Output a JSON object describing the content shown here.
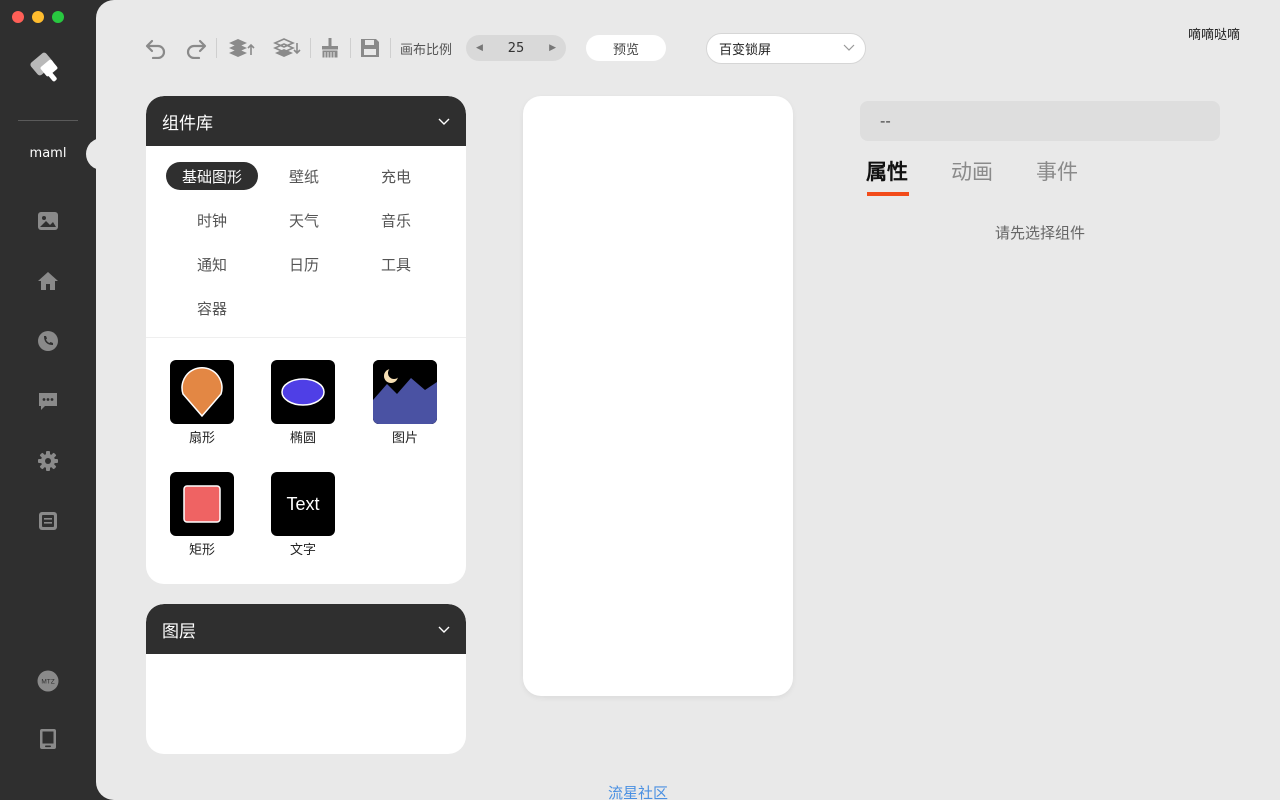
{
  "sidebar": {
    "label": "maml",
    "icons": [
      "gallery-icon",
      "home-icon",
      "phone-icon",
      "message-icon",
      "gear-icon",
      "note-icon",
      "mtz-icon",
      "tablet-icon"
    ],
    "mtz_text": "MTZ"
  },
  "toolbar": {
    "canvas_ratio_label": "画布比例",
    "canvas_ratio_value": "25",
    "preview_label": "预览",
    "select_value": "百变锁屏"
  },
  "user": {
    "name": "嘀嘀哒嘀"
  },
  "component_panel": {
    "title": "组件库",
    "categories": [
      "基础图形",
      "壁纸",
      "充电",
      "时钟",
      "天气",
      "音乐",
      "通知",
      "日历",
      "工具",
      "容器"
    ],
    "active_category": "基础图形",
    "components": [
      "扇形",
      "椭圆",
      "图片",
      "矩形",
      "文字"
    ],
    "text_thumb": "Text"
  },
  "layer_panel": {
    "title": "图层"
  },
  "properties": {
    "selected": "--",
    "tabs": [
      "属性",
      "动画",
      "事件"
    ],
    "active_tab": "属性",
    "hint": "请先选择组件"
  },
  "footer": {
    "link": "流星社区"
  },
  "colors": {
    "accent": "#f24b1a",
    "dark": "#2f2f2f",
    "background": "#e9e9e9",
    "link": "#4a90e2"
  }
}
